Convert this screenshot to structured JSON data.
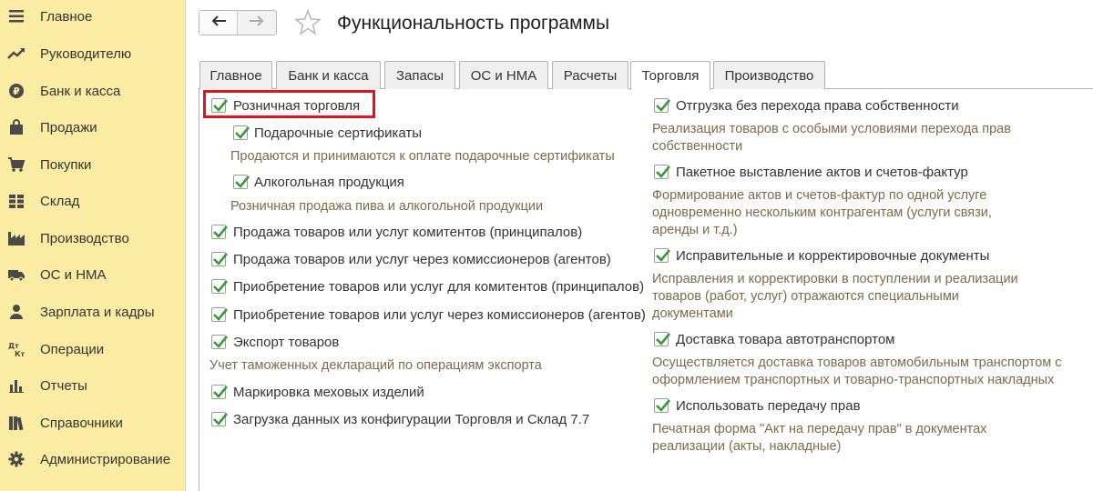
{
  "sidebar": {
    "items": [
      {
        "label": "Главное",
        "icon": "hamburger-icon"
      },
      {
        "label": "Руководителю",
        "icon": "trend-icon"
      },
      {
        "label": "Банк и касса",
        "icon": "ruble-coin-icon"
      },
      {
        "label": "Продажи",
        "icon": "shopping-bag-icon"
      },
      {
        "label": "Покупки",
        "icon": "cart-icon"
      },
      {
        "label": "Склад",
        "icon": "warehouse-grid-icon"
      },
      {
        "label": "Производство",
        "icon": "factory-icon"
      },
      {
        "label": "ОС и НМА",
        "icon": "truck-icon"
      },
      {
        "label": "Зарплата и кадры",
        "icon": "person-icon"
      },
      {
        "label": "Операции",
        "icon": "dt-kt-icon",
        "icon_text": "Дт Кт"
      },
      {
        "label": "Отчеты",
        "icon": "bar-chart-icon"
      },
      {
        "label": "Справочники",
        "icon": "books-icon"
      },
      {
        "label": "Администрирование",
        "icon": "gear-icon"
      }
    ]
  },
  "header": {
    "title": "Функциональность программы"
  },
  "tabs": [
    {
      "label": "Главное",
      "active": false
    },
    {
      "label": "Банк и касса",
      "active": false
    },
    {
      "label": "Запасы",
      "active": false
    },
    {
      "label": "ОС и НМА",
      "active": false
    },
    {
      "label": "Расчеты",
      "active": false
    },
    {
      "label": "Торговля",
      "active": true
    },
    {
      "label": "Производство",
      "active": false
    }
  ],
  "left_options": {
    "retail": {
      "label": "Розничная торговля",
      "checked": true
    },
    "gift_cards": {
      "label": "Подарочные сертификаты",
      "checked": true,
      "desc": "Продаются и принимаются к оплате подарочные сертификаты"
    },
    "alcohol": {
      "label": "Алкогольная продукция",
      "checked": true,
      "desc": "Розничная продажа пива и алкогольной продукции"
    },
    "principals_sale": {
      "label": "Продажа товаров или услуг комитентов (принципалов)",
      "checked": true
    },
    "agents_sale": {
      "label": "Продажа товаров или услуг через комиссионеров (агентов)",
      "checked": true
    },
    "principals_buy": {
      "label": "Приобретение товаров или услуг для комитентов (принципалов)",
      "checked": true
    },
    "agents_buy": {
      "label": "Приобретение товаров или услуг через комиссионеров (агентов)",
      "checked": true
    },
    "export": {
      "label": "Экспорт товаров",
      "checked": true,
      "desc": "Учет таможенных деклараций по операциям экспорта"
    },
    "fur": {
      "label": "Маркировка меховых изделий",
      "checked": true
    },
    "import_77": {
      "label": "Загрузка данных из конфигурации Торговля и Склад 7.7",
      "checked": true
    }
  },
  "right_options": {
    "shipment": {
      "label": "Отгрузка без перехода права собственности",
      "checked": true,
      "desc1": "Реализация товаров с особыми условиями перехода прав",
      "desc2": "собственности"
    },
    "batch_acts": {
      "label": "Пакетное выставление актов и счетов-фактур",
      "checked": true,
      "desc1": "Формирование актов и счетов-фактур по одной услуге",
      "desc2": "одновременно нескольким контрагентам (услуги связи,",
      "desc3": "аренды и т.д.)"
    },
    "corrections": {
      "label": "Исправительные и корректировочные документы",
      "checked": true,
      "desc1": "Исправления и корректировки в поступлении и реализации",
      "desc2": "товаров (работ, услуг) отражаются специальными",
      "desc3": "документами"
    },
    "road_delivery": {
      "label": "Доставка товара автотранспортом",
      "checked": true,
      "desc1": "Осуществляется доставка товаров автомобильным транспортом с",
      "desc2": "оформлением транспортных и товарно-транспортных накладных"
    },
    "rights_transfer": {
      "label": "Использовать передачу прав",
      "checked": true,
      "desc1": "Печатная форма \"Акт на передачу прав\" в документах",
      "desc2": "реализации (акты, накладные)"
    }
  },
  "colors": {
    "sidebar_bg": "#fbeca4",
    "check_green": "#3a9a3a",
    "desc_text": "#7d6a4a",
    "highlight_red": "#e0141e"
  }
}
